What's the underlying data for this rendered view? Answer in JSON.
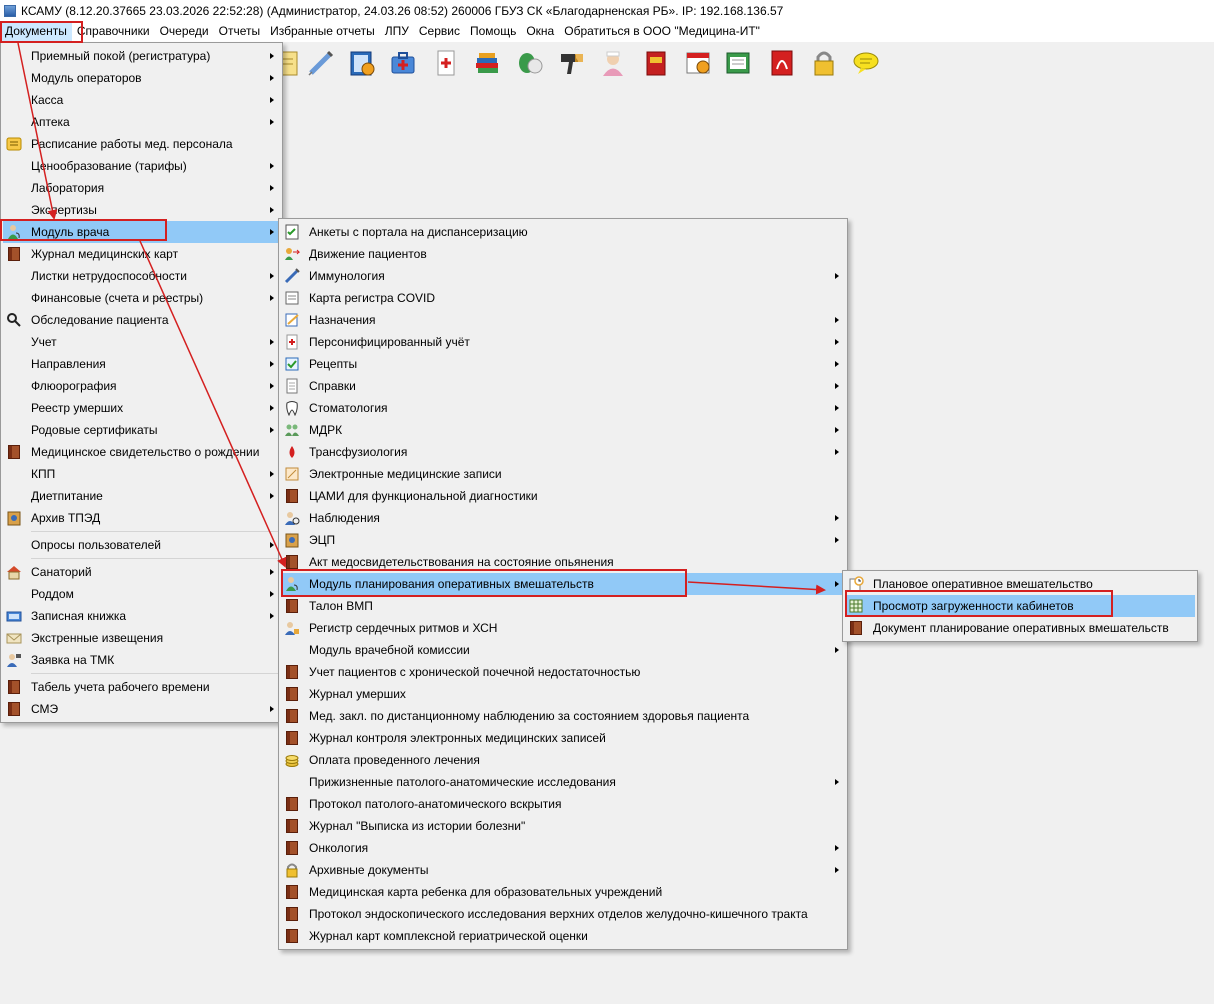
{
  "window": {
    "title": "КСАМУ (8.12.20.37665 23.03.2026 22:52:28) (Администратор, 24.03.26 08:52)  260006 ГБУЗ СК «Благодарненская РБ». IP: 192.168.136.57"
  },
  "menubar": {
    "items": [
      "Документы",
      "Справочники",
      "Очереди",
      "Отчеты",
      "Избранные отчеты",
      "ЛПУ",
      "Сервис",
      "Помощь",
      "Окна",
      "Обратиться в ООО \"Медицина-ИТ\""
    ]
  },
  "toolbar": {
    "icons": [
      "notepad-icon",
      "syringe-icon",
      "journal-clock-icon",
      "medicine-case-icon",
      "medical-card-icon",
      "books-icon",
      "pills-icon",
      "barcode-scanner-icon",
      "nurse-icon",
      "red-book-icon",
      "calendar-clock-icon",
      "certificate-icon",
      "pdf-icon",
      "lock-icon",
      "message-icon"
    ]
  },
  "documents_menu": {
    "items": [
      {
        "label": "Приемный покой (регистратура)",
        "submenu": true,
        "icon": ""
      },
      {
        "label": "Модуль операторов",
        "submenu": true,
        "icon": ""
      },
      {
        "label": "Касса",
        "submenu": true,
        "icon": ""
      },
      {
        "label": "Аптека",
        "submenu": true,
        "icon": ""
      },
      {
        "label": "Расписание работы мед. персонала",
        "submenu": false,
        "icon": "schedule-icon"
      },
      {
        "label": "Ценообразование (тарифы)",
        "submenu": true,
        "icon": ""
      },
      {
        "label": "Лаборатория",
        "submenu": true,
        "icon": ""
      },
      {
        "label": "Экспертизы",
        "submenu": true,
        "icon": ""
      },
      {
        "label": "Модуль врача",
        "submenu": true,
        "icon": "doctor-icon",
        "highlighted": true
      },
      {
        "label": "Журнал медицинских карт",
        "submenu": false,
        "icon": "book-icon"
      },
      {
        "label": "Листки нетрудоспособности",
        "submenu": true,
        "icon": ""
      },
      {
        "label": "Финансовые (счета и реестры)",
        "submenu": true,
        "icon": ""
      },
      {
        "label": "Обследование пациента",
        "submenu": false,
        "icon": "magnifier-icon"
      },
      {
        "label": "Учет",
        "submenu": true,
        "icon": ""
      },
      {
        "label": "Направления",
        "submenu": true,
        "icon": ""
      },
      {
        "label": "Флюорография",
        "submenu": true,
        "icon": ""
      },
      {
        "label": "Реестр умерших",
        "submenu": true,
        "icon": ""
      },
      {
        "label": "Родовые сертификаты",
        "submenu": true,
        "icon": ""
      },
      {
        "label": "Медицинское свидетельство о рождении",
        "submenu": false,
        "icon": "book-icon"
      },
      {
        "label": "КПП",
        "submenu": true,
        "icon": ""
      },
      {
        "label": "Диетпитание",
        "submenu": true,
        "icon": ""
      },
      {
        "label": "Архив ТПЭД",
        "submenu": false,
        "icon": "archive-icon"
      },
      {
        "separator": true
      },
      {
        "label": "Опросы пользователей",
        "submenu": true,
        "icon": ""
      },
      {
        "separator": true
      },
      {
        "label": "Санаторий",
        "submenu": true,
        "icon": "house-icon"
      },
      {
        "label": "Роддом",
        "submenu": true,
        "icon": ""
      },
      {
        "label": "Записная книжка",
        "submenu": true,
        "icon": "notebook-icon"
      },
      {
        "label": "Экстренные извещения",
        "submenu": false,
        "icon": "envelope-icon"
      },
      {
        "label": "Заявка на ТМК",
        "submenu": false,
        "icon": "telemedicine-icon"
      },
      {
        "separator": true
      },
      {
        "label": "Табель учета рабочего времени",
        "submenu": false,
        "icon": "book-icon"
      },
      {
        "label": "СМЭ",
        "submenu": true,
        "icon": "book-icon"
      }
    ]
  },
  "doctor_menu": {
    "items": [
      {
        "label": "Анкеты с портала на диспансеризацию",
        "submenu": false,
        "icon": "form-check-icon"
      },
      {
        "label": "Движение пациентов",
        "submenu": false,
        "icon": "patients-move-icon"
      },
      {
        "label": "Иммунология",
        "submenu": true,
        "icon": "syringe-icon"
      },
      {
        "label": "Карта регистра COVID",
        "submenu": false,
        "icon": "card-icon"
      },
      {
        "label": "Назначения",
        "submenu": true,
        "icon": "prescription-icon"
      },
      {
        "label": "Персонифицированный учёт",
        "submenu": true,
        "icon": "medical-doc-icon"
      },
      {
        "label": "Рецепты",
        "submenu": true,
        "icon": "recipe-icon"
      },
      {
        "label": "Справки",
        "submenu": true,
        "icon": "document-icon"
      },
      {
        "label": "Стоматология",
        "submenu": true,
        "icon": "tooth-icon"
      },
      {
        "label": "МДРК",
        "submenu": true,
        "icon": "group-icon"
      },
      {
        "label": "Трансфузиология",
        "submenu": true,
        "icon": "blood-drop-icon"
      },
      {
        "label": "Электронные медицинские записи",
        "submenu": false,
        "icon": "emr-icon"
      },
      {
        "label": "ЦАМИ для функциональной диагностики",
        "submenu": false,
        "icon": "book-icon"
      },
      {
        "label": "Наблюдения",
        "submenu": true,
        "icon": "observation-icon"
      },
      {
        "label": "ЭЦП",
        "submenu": true,
        "icon": "signature-icon"
      },
      {
        "label": "Акт медосвидетельствования на состояние опьянения",
        "submenu": false,
        "icon": "book-icon"
      },
      {
        "label": "Модуль планирования оперативных вмешательств",
        "submenu": true,
        "icon": "doctor-icon",
        "highlighted": true
      },
      {
        "label": "Талон ВМП",
        "submenu": false,
        "icon": "book-icon"
      },
      {
        "label": "Регистр сердечных ритмов и ХСН",
        "submenu": false,
        "icon": "registry-icon"
      },
      {
        "label": "Модуль врачебной комиссии",
        "submenu": true,
        "icon": ""
      },
      {
        "label": "Учет пациентов с хронической почечной недостаточностью",
        "submenu": false,
        "icon": "book-icon"
      },
      {
        "label": "Журнал умерших",
        "submenu": false,
        "icon": "book-icon"
      },
      {
        "label": "Мед. закл. по дистанционному наблюдению за состоянием здоровья пациента",
        "submenu": false,
        "icon": "book-icon"
      },
      {
        "label": "Журнал контроля электронных медицинских записей",
        "submenu": false,
        "icon": "book-icon"
      },
      {
        "label": "Оплата проведенного лечения",
        "submenu": false,
        "icon": "coins-icon"
      },
      {
        "label": "Прижизненные патолого-анатомические исследования",
        "submenu": true,
        "icon": ""
      },
      {
        "label": "Протокол патолого-анатомического вскрытия",
        "submenu": false,
        "icon": "book-icon"
      },
      {
        "label": "Журнал \"Выписка из истории болезни\"",
        "submenu": false,
        "icon": "book-icon"
      },
      {
        "label": "Онкология",
        "submenu": true,
        "icon": "book-icon"
      },
      {
        "label": "Архивные документы",
        "submenu": true,
        "icon": "lock-icon"
      },
      {
        "label": "Медицинская карта ребенка для образовательных учреждений",
        "submenu": false,
        "icon": "book-icon"
      },
      {
        "label": "Протокол эндоскопического исследования верхних отделов желудочно-кишечного тракта",
        "submenu": false,
        "icon": "book-icon"
      },
      {
        "label": "Журнал карт комплексной гериатрической оценки",
        "submenu": false,
        "icon": "book-icon"
      }
    ]
  },
  "planning_menu": {
    "items": [
      {
        "label": "Плановое оперативное вмешательство",
        "icon": "clock-doc-icon"
      },
      {
        "label": "Просмотр загруженности кабинетов",
        "icon": "grid-table-icon",
        "highlighted": true
      },
      {
        "label": "Документ планирование оперативных вмешательств",
        "icon": "book-icon"
      }
    ]
  },
  "colors": {
    "highlight": "#91c9f7",
    "menubar_active": "#cce8ff",
    "annotation": "#d42020"
  }
}
